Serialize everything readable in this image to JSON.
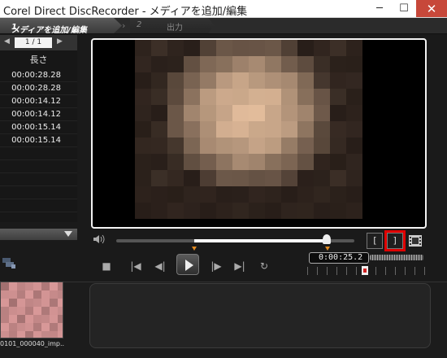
{
  "window": {
    "title": "Corel Direct DiscRecorder - メディアを追加/編集",
    "min_glyph": "─",
    "max_glyph": "☐",
    "close_glyph": "✕"
  },
  "steps": [
    {
      "number": "1",
      "label": "メディアを追加/編集"
    },
    {
      "number": "2",
      "label": "出力"
    }
  ],
  "media_list": {
    "pager": "1 / 1",
    "column_header": "長さ",
    "durations": [
      "00:00:28.28",
      "00:00:28.28",
      "00:00:14.12",
      "00:00:14.12",
      "00:00:15.14",
      "00:00:15.14"
    ]
  },
  "player": {
    "timecode": "0:00:25.2",
    "mark_in_label": "[",
    "mark_out_label": "]",
    "seek_position": 0.88
  },
  "timeline": {
    "clip_label": "0101_000040_imp..."
  },
  "colors": {
    "highlight": "#e00000",
    "accent_marker": "#e28b22"
  },
  "icons": [
    "volume-icon",
    "film-icon",
    "stop-icon",
    "go-start-icon",
    "step-back-icon",
    "play-icon",
    "step-forward-icon",
    "go-end-icon",
    "repeat-icon"
  ]
}
